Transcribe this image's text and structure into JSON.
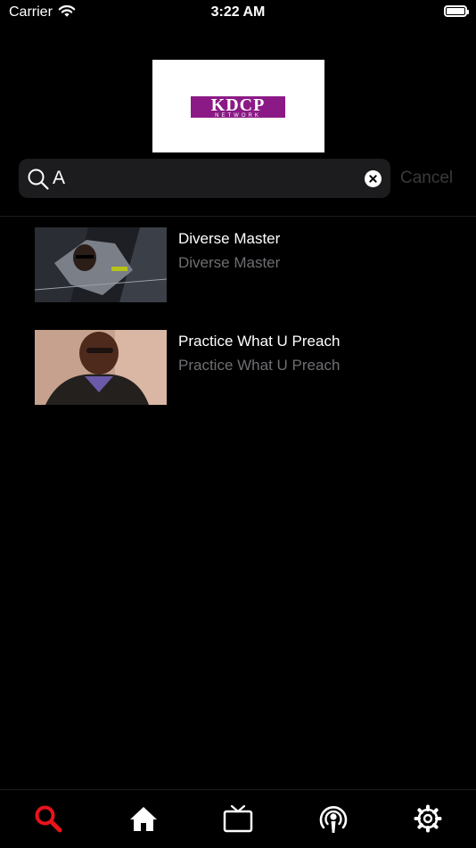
{
  "status_bar": {
    "carrier": "Carrier",
    "time": "3:22 AM",
    "battery_level": 1.0
  },
  "logo": {
    "main": "KDCP",
    "sub": "NETWORK"
  },
  "search": {
    "value": "A",
    "cancel_label": "Cancel"
  },
  "results": [
    {
      "title": "Diverse Master",
      "subtitle": "Diverse Master",
      "thumbnail": "diverse-master-thumbnail"
    },
    {
      "title": "Practice What U Preach",
      "subtitle": "Practice What U Preach",
      "thumbnail": "practice-what-u-preach-thumbnail"
    }
  ],
  "tab_bar": {
    "active_color": "#e8141b",
    "inactive_color": "#ffffff",
    "tabs": [
      {
        "icon": "search-icon",
        "active": true
      },
      {
        "icon": "home-icon",
        "active": false
      },
      {
        "icon": "tv-icon",
        "active": false
      },
      {
        "icon": "podcast-icon",
        "active": false
      },
      {
        "icon": "gear-icon",
        "active": false
      }
    ]
  }
}
